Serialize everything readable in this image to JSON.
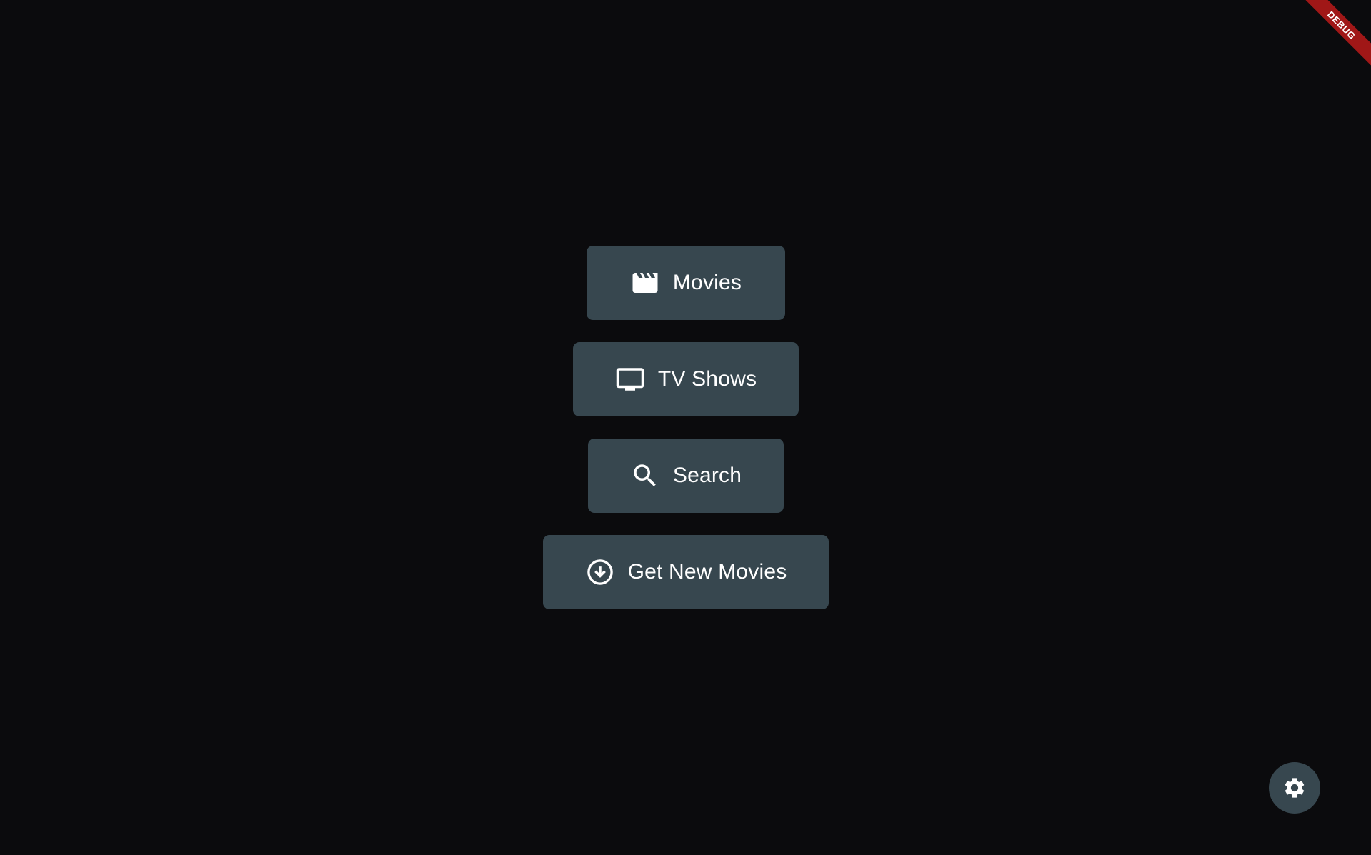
{
  "theme": {
    "background": "#0b0b0d",
    "button_bg": "#37474f",
    "text": "#ffffff",
    "debug_banner": "#a01717"
  },
  "menu": {
    "items": [
      {
        "label": "Movies",
        "icon": "movie-clapperboard-icon"
      },
      {
        "label": "TV Shows",
        "icon": "tv-monitor-icon"
      },
      {
        "label": "Search",
        "icon": "search-icon"
      },
      {
        "label": "Get New Movies",
        "icon": "download-circle-icon"
      }
    ]
  },
  "fab": {
    "icon": "gear-icon"
  },
  "debug_banner": {
    "label": "DEBUG"
  }
}
